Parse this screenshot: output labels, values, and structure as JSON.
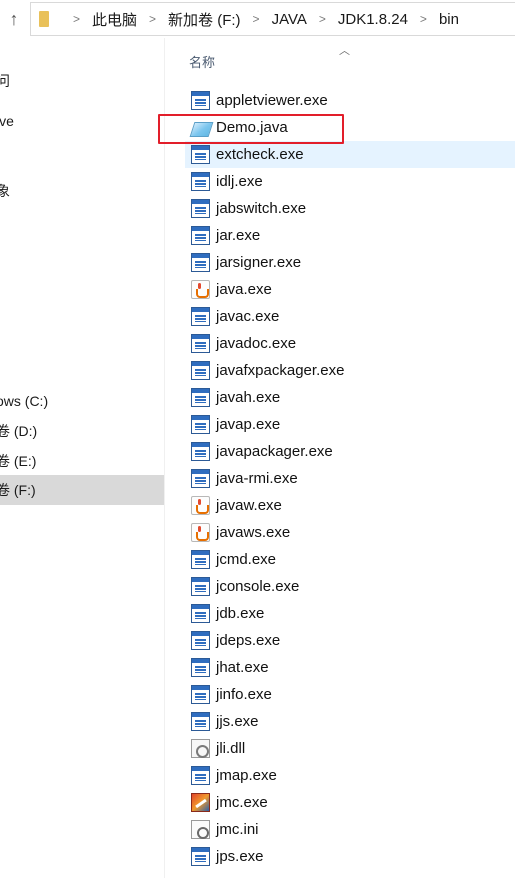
{
  "addressbar": {
    "crumbs": [
      "此电脑",
      "新加卷 (F:)",
      "JAVA",
      "JDK1.8.24",
      "bin"
    ],
    "separator": ">"
  },
  "nav": {
    "items": [
      {
        "label": "问",
        "selected": false
      },
      {
        "label": "ive",
        "selected": false
      },
      {
        "label": "象",
        "selected": false
      },
      {
        "label": "ows (C:)",
        "selected": false
      },
      {
        "label": "卷 (D:)",
        "selected": false
      },
      {
        "label": "卷 (E:)",
        "selected": false
      },
      {
        "label": "卷 (F:)",
        "selected": true
      }
    ]
  },
  "filelist": {
    "column_header": "名称",
    "files": [
      {
        "name": "appletviewer.exe",
        "icon": "exe-icon"
      },
      {
        "name": "Demo.java",
        "icon": "java-source-icon",
        "highlighted": true
      },
      {
        "name": "extcheck.exe",
        "icon": "exe-icon",
        "hover": true
      },
      {
        "name": "idlj.exe",
        "icon": "exe-icon"
      },
      {
        "name": "jabswitch.exe",
        "icon": "exe-icon"
      },
      {
        "name": "jar.exe",
        "icon": "exe-icon"
      },
      {
        "name": "jarsigner.exe",
        "icon": "exe-icon"
      },
      {
        "name": "java.exe",
        "icon": "java-cup-icon"
      },
      {
        "name": "javac.exe",
        "icon": "exe-icon"
      },
      {
        "name": "javadoc.exe",
        "icon": "exe-icon"
      },
      {
        "name": "javafxpackager.exe",
        "icon": "exe-icon"
      },
      {
        "name": "javah.exe",
        "icon": "exe-icon"
      },
      {
        "name": "javap.exe",
        "icon": "exe-icon"
      },
      {
        "name": "javapackager.exe",
        "icon": "exe-icon"
      },
      {
        "name": "java-rmi.exe",
        "icon": "exe-icon"
      },
      {
        "name": "javaw.exe",
        "icon": "java-cup-icon"
      },
      {
        "name": "javaws.exe",
        "icon": "java-cup-icon"
      },
      {
        "name": "jcmd.exe",
        "icon": "exe-icon"
      },
      {
        "name": "jconsole.exe",
        "icon": "exe-icon"
      },
      {
        "name": "jdb.exe",
        "icon": "exe-icon"
      },
      {
        "name": "jdeps.exe",
        "icon": "exe-icon"
      },
      {
        "name": "jhat.exe",
        "icon": "exe-icon"
      },
      {
        "name": "jinfo.exe",
        "icon": "exe-icon"
      },
      {
        "name": "jjs.exe",
        "icon": "exe-icon"
      },
      {
        "name": "jli.dll",
        "icon": "dll-icon"
      },
      {
        "name": "jmap.exe",
        "icon": "exe-icon"
      },
      {
        "name": "jmc.exe",
        "icon": "jmc-icon"
      },
      {
        "name": "jmc.ini",
        "icon": "ini-icon"
      },
      {
        "name": "jps.exe",
        "icon": "exe-icon"
      }
    ]
  },
  "colors": {
    "highlight_border": "#e21e2a",
    "hover_row": "#e5f3ff",
    "selected_nav": "#d9d9d9"
  }
}
